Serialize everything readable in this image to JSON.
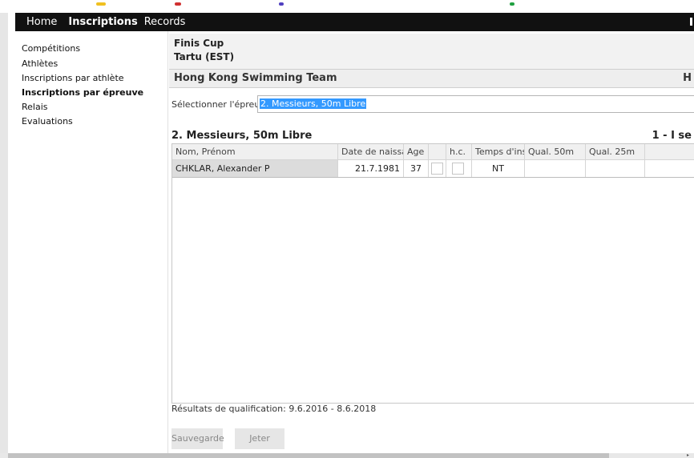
{
  "nav": {
    "items": [
      {
        "label": "Home",
        "active": false
      },
      {
        "label": "Inscriptions",
        "active": true
      },
      {
        "label": "Records",
        "active": false
      }
    ]
  },
  "sidebar": {
    "items": [
      {
        "label": "Compétitions",
        "bold": false
      },
      {
        "label": "Athlètes",
        "bold": false
      },
      {
        "label": "Inscriptions par athlète",
        "bold": false
      },
      {
        "label": "Inscriptions par épreuve",
        "bold": true
      },
      {
        "label": "Relais",
        "bold": false
      },
      {
        "label": "Evaluations",
        "bold": false
      }
    ]
  },
  "competition": {
    "name": "Finis Cup",
    "location": "Tartu (EST)"
  },
  "team": {
    "name": "Hong Kong Swimming Team",
    "right_text": "H"
  },
  "event_select": {
    "label": "Sélectionner l'épreuve:",
    "value": "2. Messieurs, 50m Libre"
  },
  "event": {
    "title": "2. Messieurs, 50m Libre",
    "right_text": "1 - I se"
  },
  "table": {
    "headers": [
      "Nom, Prénom",
      "Date de naissa",
      "Age",
      "",
      "h.c.",
      "Temps d'insc",
      "Qual. 50m",
      "Qual. 25m",
      ""
    ],
    "rows": [
      {
        "name": "CHKLAR, Alexander P",
        "birth": "21.7.1981",
        "age": "37",
        "checked1": false,
        "hc": false,
        "time": "NT",
        "qual50": "",
        "qual25": "",
        "extra": ""
      }
    ]
  },
  "qualification_text": "Résultats de qualification: 9.6.2016 - 8.6.2018",
  "buttons": {
    "save": "Sauvegarde",
    "discard": "Jeter"
  },
  "colors": {
    "navbar": "#111111",
    "selection": "#3399ff",
    "name_cell": "#dcdcdc"
  }
}
